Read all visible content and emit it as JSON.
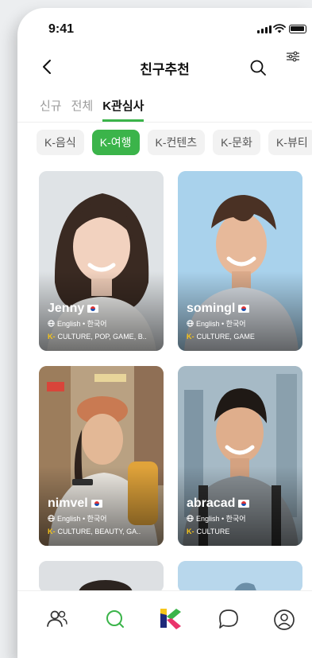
{
  "status": {
    "time": "9:41"
  },
  "header": {
    "title": "친구추천"
  },
  "tabs": [
    {
      "label": "신규",
      "active": false
    },
    {
      "label": "전체",
      "active": false
    },
    {
      "label": "K관심사",
      "active": true
    }
  ],
  "chips": [
    {
      "label": "K-음식",
      "active": false
    },
    {
      "label": "K-여행",
      "active": true
    },
    {
      "label": "K-컨텐츠",
      "active": false
    },
    {
      "label": "K-문화",
      "active": false
    },
    {
      "label": "K-뷰티",
      "active": false
    }
  ],
  "cards": [
    {
      "name": "Jenny",
      "languages": "English • 한국어",
      "k_badge": "K-",
      "interests": "CULTURE, POP, GAME, B.."
    },
    {
      "name": "somingl",
      "languages": "English • 한국어",
      "k_badge": "K-",
      "interests": "CULTURE, GAME"
    },
    {
      "name": "nimvel",
      "languages": "English • 한국어",
      "k_badge": "K-",
      "interests": "CULTURE, BEAUTY, GA.."
    },
    {
      "name": "abracad",
      "languages": "English • 한국어",
      "k_badge": "K-",
      "interests": "CULTURE"
    }
  ],
  "colors": {
    "accent": "#3bb44a",
    "k_badge": "#f6c51a"
  },
  "nav": {
    "items": [
      "friends-icon",
      "search-icon",
      "app-logo-icon",
      "chat-icon",
      "profile-icon"
    ],
    "active": "search-icon"
  }
}
